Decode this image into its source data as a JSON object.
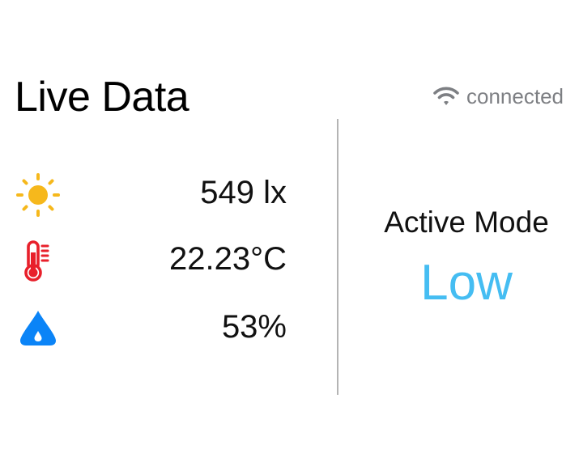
{
  "header": {
    "title": "Live Data",
    "connection_status": "connected",
    "connection_icon": "wifi-icon"
  },
  "readings": [
    {
      "icon": "sun-icon",
      "value": "549 lx",
      "color": "#f6b81c"
    },
    {
      "icon": "thermometer-icon",
      "value": "22.23°C",
      "color": "#e8202b"
    },
    {
      "icon": "water-drop-icon",
      "value": "53%",
      "color": "#0b84f7"
    }
  ],
  "mode": {
    "label": "Active Mode",
    "value": "Low",
    "value_color": "#45bdf2"
  },
  "colors": {
    "status_text": "#7d7f83",
    "divider": "#b4b4b4"
  }
}
